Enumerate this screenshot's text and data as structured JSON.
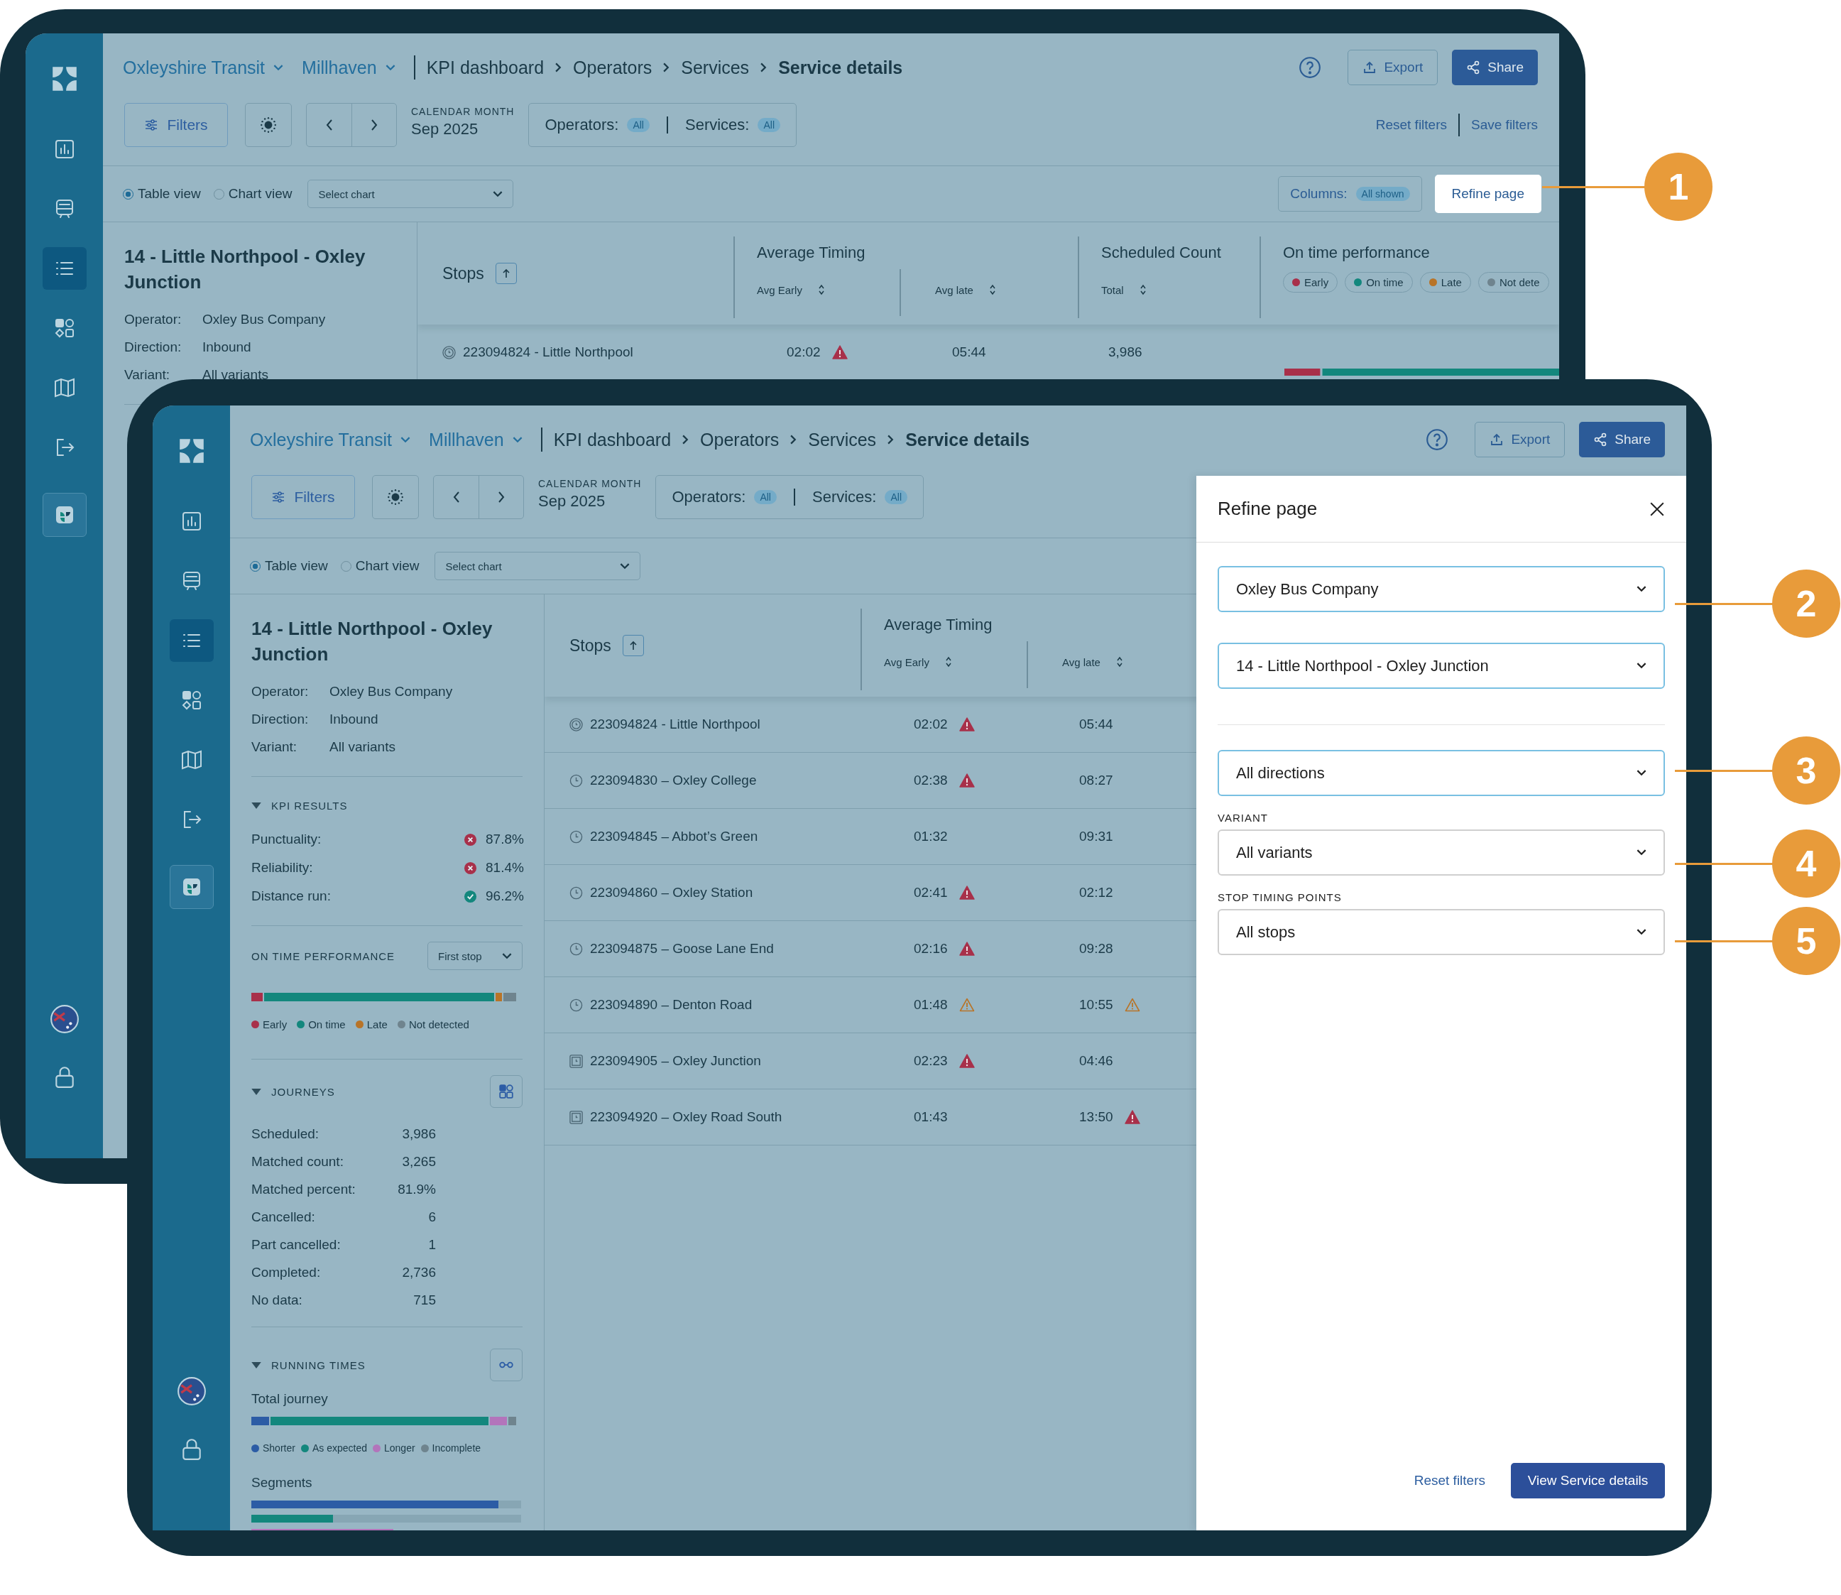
{
  "tablets": [
    {
      "sidebar": {
        "items": [
          {
            "selected": false
          },
          {
            "selected": false
          },
          {
            "selected": true
          },
          {
            "selected": false
          },
          {
            "selected": false
          },
          {
            "selected": false
          },
          {
            "selected": false
          }
        ]
      },
      "header": {
        "organisation": "Oxleyshire Transit",
        "region": "Millhaven",
        "breadcrumbs": [
          "KPI dashboard",
          "Operators",
          "Services",
          "Service details"
        ],
        "export": "Export",
        "share": "Share"
      },
      "toolbar": {
        "filters": "Filters",
        "month_label": "CALENDAR MONTH",
        "month": "Sep 2025",
        "operators_label": "Operators:",
        "operators_value": "All",
        "services_label": "Services:",
        "services_value": "All",
        "links": [
          "Reset filters",
          "Save filters"
        ]
      },
      "view_bar": {
        "views": [
          {
            "label": "Table view",
            "selected": true
          },
          {
            "label": "Chart view",
            "selected": false
          }
        ],
        "chart_select": "Select chart",
        "columns_label": "Columns:",
        "columns_value": "All shown",
        "refine": "Refine page"
      },
      "service": {
        "title": "14 - Little Northpool - Oxley Junction",
        "details": [
          {
            "label": "Operator:",
            "value": "Oxley Bus Company"
          },
          {
            "label": "Direction:",
            "value": "Inbound"
          },
          {
            "label": "Variant:",
            "value": "All variants"
          }
        ]
      },
      "table": {
        "stops_label": "Stops",
        "groups": [
          {
            "title": "Average Timing",
            "columns": [
              "Avg Early",
              "Avg late"
            ]
          },
          {
            "title": "Scheduled Count",
            "columns": [
              "Total"
            ]
          }
        ],
        "performance": {
          "title": "On time performance",
          "legend": [
            {
              "label": "Early",
              "color": "#a8304a"
            },
            {
              "label": "On time",
              "color": "#13877d"
            },
            {
              "label": "Late",
              "color": "#b87428"
            },
            {
              "label": "Not dete",
              "color": "#6f848e"
            }
          ]
        },
        "rows": [
          {
            "kind": "start",
            "stop": "223094824 - Little Northpool",
            "early": {
              "time": "02:02",
              "alert": true,
              "severe": true
            },
            "late": {
              "time": "05:44"
            },
            "scheduled": "3,986"
          }
        ]
      }
    },
    {
      "sidebar": {
        "items": [
          {
            "selected": false
          },
          {
            "selected": false
          },
          {
            "selected": true
          },
          {
            "selected": false
          },
          {
            "selected": false
          },
          {
            "selected": false
          },
          {
            "selected": false
          }
        ]
      },
      "header": {
        "organisation": "Oxleyshire Transit",
        "region": "Millhaven",
        "breadcrumbs": [
          "KPI dashboard",
          "Operators",
          "Services",
          "Service details"
        ],
        "export": "Export",
        "share": "Share"
      },
      "toolbar": {
        "filters": "Filters",
        "month_label": "CALENDAR MONTH",
        "month": "Sep 2025",
        "operators_label": "Operators:",
        "operators_value": "All",
        "services_label": "Services:",
        "services_value": "All"
      },
      "view_bar": {
        "views": [
          {
            "label": "Table view",
            "selected": true
          },
          {
            "label": "Chart view",
            "selected": false
          }
        ],
        "chart_select": "Select chart"
      },
      "service": {
        "title": "14 - Little Northpool - Oxley Junction",
        "details": [
          {
            "label": "Operator:",
            "value": "Oxley Bus Company"
          },
          {
            "label": "Direction:",
            "value": "Inbound"
          },
          {
            "label": "Variant:",
            "value": "All variants"
          }
        ],
        "kpi": {
          "title": "KPI RESULTS",
          "expanded": true,
          "items": [
            {
              "label": "Punctuality:",
              "value": "87.8%",
              "passed": false
            },
            {
              "label": "Reliability:",
              "value": "81.4%",
              "passed": false
            },
            {
              "label": "Distance run:",
              "value": "96.2%",
              "passed": true
            }
          ]
        },
        "on_time": {
          "title": "ON TIME PERFORMANCE",
          "select": "First stop",
          "legend": [
            {
              "label": "Early",
              "color": "#a8304a"
            },
            {
              "label": "On time",
              "color": "#13877d"
            },
            {
              "label": "Late",
              "color": "#b87428"
            },
            {
              "label": "Not detected",
              "color": "#6f848e"
            }
          ]
        },
        "journeys": {
          "title": "JOURNEYS",
          "expanded": true,
          "items": [
            {
              "label": "Scheduled:",
              "value": "3,986"
            },
            {
              "label": "Matched count:",
              "value": "3,265"
            },
            {
              "label": "Matched percent:",
              "value": "81.9%"
            },
            {
              "label": "Cancelled:",
              "value": "6"
            },
            {
              "label": "Part cancelled:",
              "value": "1"
            },
            {
              "label": "Completed:",
              "value": "2,736"
            },
            {
              "label": "No data:",
              "value": "715"
            }
          ]
        },
        "running_times": {
          "title": "RUNNING TIMES",
          "expanded": true,
          "total_label": "Total journey",
          "legend": [
            {
              "label": "Shorter",
              "color": "#2c5ca5"
            },
            {
              "label": "As expected",
              "color": "#13877d"
            },
            {
              "label": "Longer",
              "color": "#b374bb"
            },
            {
              "label": "Incomplete",
              "color": "#6f848e"
            }
          ],
          "segments_label": "Segments"
        }
      },
      "table": {
        "stops_label": "Stops",
        "groups": [
          {
            "title": "Average Timing",
            "columns": [
              "Avg Early",
              "Avg late"
            ]
          }
        ],
        "rows": [
          {
            "kind": "start",
            "stop": "223094824 - Little Northpool",
            "early": {
              "time": "02:02",
              "alert": true,
              "severe": true
            },
            "late": {
              "time": "05:44"
            }
          },
          {
            "kind": "stop",
            "stop": "223094830 – Oxley College",
            "early": {
              "time": "02:38",
              "alert": true,
              "severe": true
            },
            "late": {
              "time": "08:27"
            }
          },
          {
            "kind": "stop",
            "stop": "223094845 – Abbot’s Green",
            "early": {
              "time": "01:32"
            },
            "late": {
              "time": "09:31"
            }
          },
          {
            "kind": "stop",
            "stop": "223094860 – Oxley Station",
            "early": {
              "time": "02:41",
              "alert": true,
              "severe": true
            },
            "late": {
              "time": "02:12"
            }
          },
          {
            "kind": "stop",
            "stop": "223094875 – Goose Lane End",
            "early": {
              "time": "02:16",
              "alert": true,
              "severe": true
            },
            "late": {
              "time": "09:28"
            }
          },
          {
            "kind": "stop",
            "stop": "223094890 – Denton Road",
            "early": {
              "time": "01:48",
              "alert": true,
              "severe": false
            },
            "late": {
              "time": "10:55",
              "alert": true,
              "severe": false
            }
          },
          {
            "kind": "timing",
            "stop": "223094905 – Oxley Junction",
            "early": {
              "time": "02:23",
              "alert": true,
              "severe": true
            },
            "late": {
              "time": "04:46"
            }
          },
          {
            "kind": "timing",
            "stop": "223094920 – Oxley Road South",
            "early": {
              "time": "01:43"
            },
            "late": {
              "time": "13:50",
              "alert": true,
              "severe": true
            }
          }
        ]
      },
      "refine": {
        "title": "Refine page",
        "groups": [
          {
            "fields": [
              {
                "value": "Oxley Bus Company",
                "highlighted": true
              },
              {
                "value": "14 - Little Northpool - Oxley Junction",
                "highlighted": true
              }
            ]
          },
          {
            "fields": [
              {
                "value": "All directions",
                "highlighted": true
              },
              {
                "label": "VARIANT",
                "value": "All variants",
                "highlighted": false
              },
              {
                "label": "STOP TIMING POINTS",
                "value": "All stops",
                "highlighted": false
              }
            ]
          }
        ],
        "reset": "Reset filters",
        "submit": "View Service details"
      }
    }
  ],
  "callouts": [
    {
      "number": "1"
    },
    {
      "number": "2"
    },
    {
      "number": "3"
    },
    {
      "number": "4"
    },
    {
      "number": "5"
    }
  ]
}
